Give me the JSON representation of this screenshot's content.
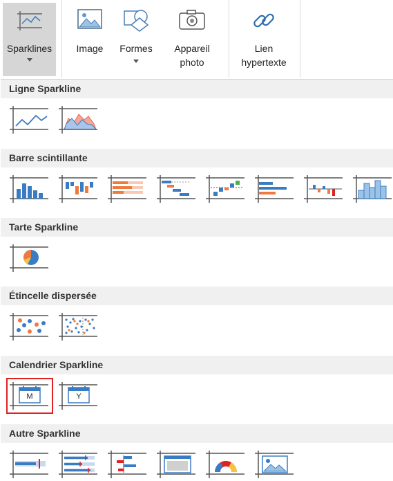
{
  "ribbon": {
    "sparklines": "Sparklines",
    "image": "Image",
    "formes": "Formes",
    "appareil": "Appareil",
    "photo": "photo",
    "lien": "Lien",
    "hypertexte": "hypertexte"
  },
  "sections": {
    "ligne": "Ligne Sparkline",
    "barre": "Barre scintillante",
    "tarte": "Tarte Sparkline",
    "etincelle": "Étincelle dispersée",
    "calendrier": "Calendrier Sparkline",
    "autre": "Autre Sparkline"
  },
  "calendar": {
    "month_glyph": "M",
    "year_glyph": "Y"
  },
  "colors": {
    "blue": "#3a7cc4",
    "orange": "#f07a3e",
    "red_highlight": "#e0211f",
    "axis": "#555555"
  }
}
